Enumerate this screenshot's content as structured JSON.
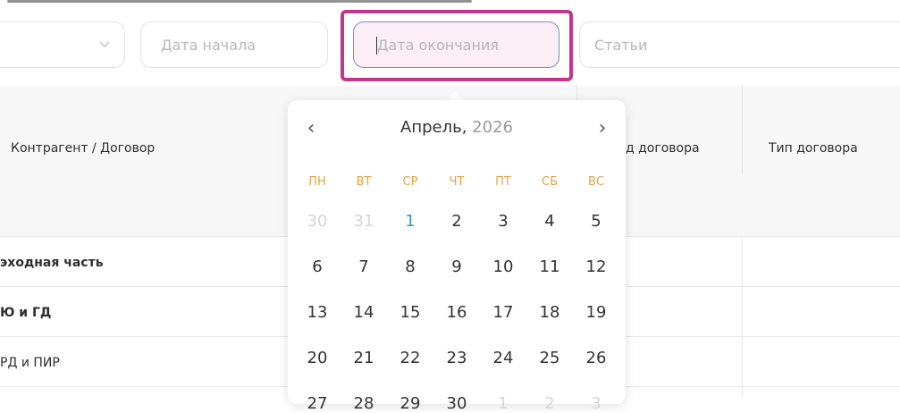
{
  "filters": {
    "start_placeholder": "Дата начала",
    "end_placeholder": "Дата окончания",
    "articles_placeholder": "Статьи"
  },
  "table": {
    "headers": [
      "Контрагент / Договор",
      "д договора",
      "Тип договора"
    ],
    "rows": [
      "эходная часть",
      "Ю и ГД",
      "РД и ПИР"
    ]
  },
  "calendar": {
    "month": "Апрель,",
    "year": "2026",
    "weekdays": [
      "ПН",
      "ВТ",
      "СР",
      "ЧТ",
      "ПТ",
      "СБ",
      "ВС"
    ],
    "weeks": [
      [
        "30",
        "31",
        "1",
        "2",
        "3",
        "4",
        "5"
      ],
      [
        "6",
        "7",
        "8",
        "9",
        "10",
        "11",
        "12"
      ],
      [
        "13",
        "14",
        "15",
        "16",
        "17",
        "18",
        "19"
      ],
      [
        "20",
        "21",
        "22",
        "23",
        "24",
        "25",
        "26"
      ],
      [
        "27",
        "28",
        "29",
        "30",
        "1",
        "2",
        "3"
      ]
    ],
    "muted": [
      [
        0,
        0
      ],
      [
        0,
        1
      ],
      [
        4,
        4
      ],
      [
        4,
        5
      ],
      [
        4,
        6
      ]
    ],
    "today": [
      0,
      2
    ]
  },
  "colors": {
    "highlight": "#c2358b",
    "weekday": "#e3a24a",
    "today": "#3b9bb8"
  },
  "icons": {
    "select_chevron": "chevron-down-icon",
    "prev": "chevron-left-icon",
    "next": "chevron-right-icon"
  }
}
